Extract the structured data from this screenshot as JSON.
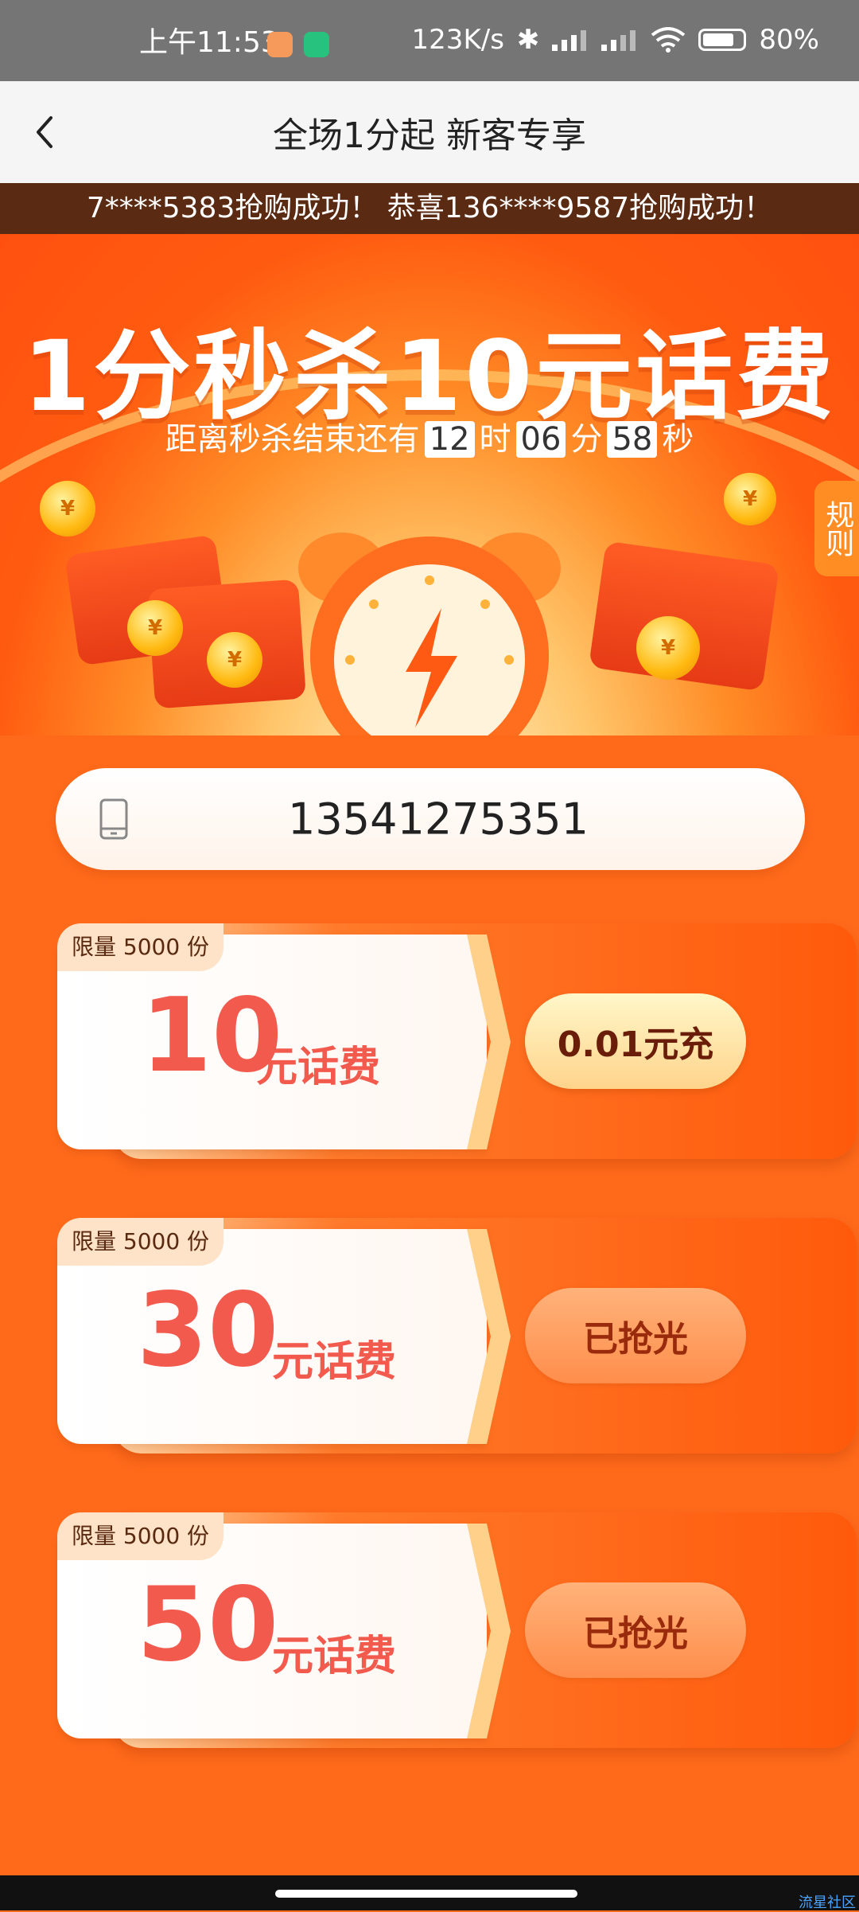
{
  "status_bar": {
    "time": "上午11:53",
    "network_speed": "123K/s",
    "battery": "80%"
  },
  "nav": {
    "title": "全场1分起 新客专享"
  },
  "ticker": {
    "text": "7****5383抢购成功！ 恭喜136****9587抢购成功！"
  },
  "banner": {
    "title": "1分秒杀10元话费",
    "countdown_prefix": "距离秒杀结束还有",
    "hours": "12",
    "hours_unit": "时",
    "minutes": "06",
    "minutes_unit": "分",
    "seconds": "58",
    "seconds_unit": "秒",
    "rules_label": "规则",
    "coin_symbol": "¥"
  },
  "phone": {
    "value": "13541275351"
  },
  "offers": [
    {
      "limit": "限量 5000 份",
      "amount": "10",
      "unit": "元话费",
      "button": "0.01元充",
      "state": "active"
    },
    {
      "limit": "限量 5000 份",
      "amount": "30",
      "unit": "元话费",
      "button": "已抢光",
      "state": "sold_out"
    },
    {
      "limit": "限量 5000 份",
      "amount": "50",
      "unit": "元话费",
      "button": "已抢光",
      "state": "sold_out"
    }
  ],
  "watermark": "流星社区",
  "colors": {
    "page_bg": "#ff6a1a",
    "accent_red": "#f25a4e",
    "ticker_bg": "#5b2a12"
  }
}
